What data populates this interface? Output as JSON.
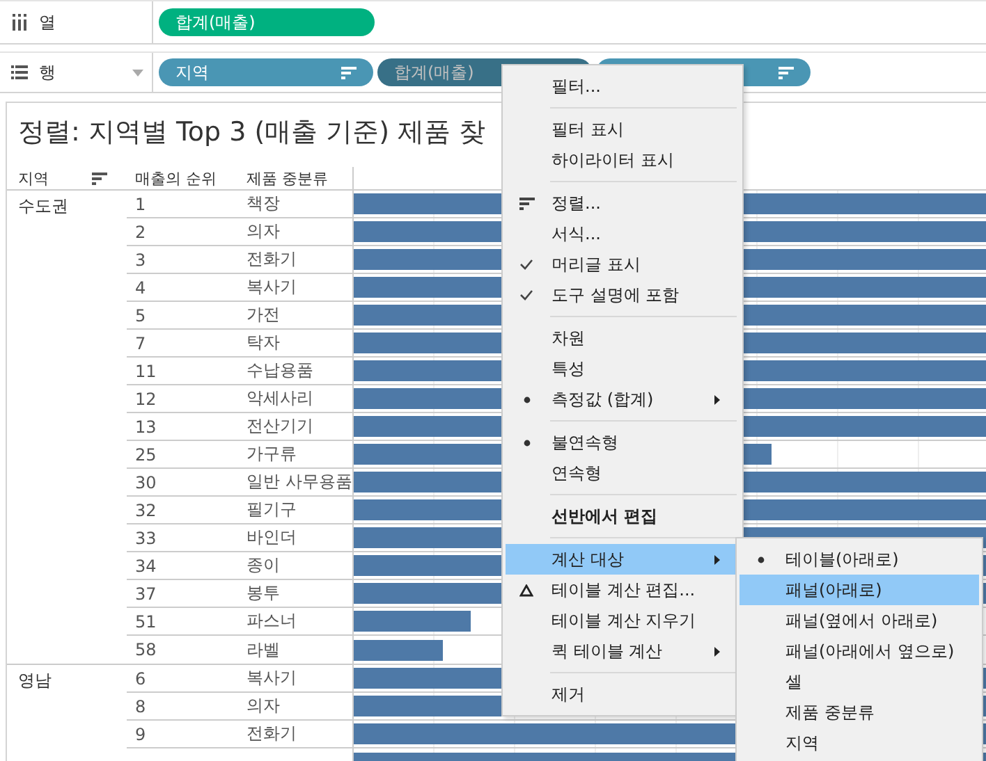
{
  "columns_shelf": {
    "label": "열",
    "pills": [
      {
        "label": "합계(매출)",
        "kind": "continuous",
        "selected": false,
        "sort": false
      }
    ]
  },
  "rows_shelf": {
    "label": "행",
    "pills": [
      {
        "label": "지역",
        "kind": "discrete",
        "selected": false,
        "sort": true
      },
      {
        "label": "합계(매출)",
        "kind": "discrete",
        "selected": true,
        "sort": false
      },
      {
        "kind": "discrete",
        "selected": false,
        "sort": true
      }
    ]
  },
  "title": "정렬: 지역별 Top 3 (매출 기준) 제품 찾",
  "table": {
    "columns": [
      "지역",
      "매출의 순위",
      "제품 중분류"
    ],
    "groups": [
      {
        "region": "수도권",
        "rows": [
          {
            "rank": "1",
            "product": "책장",
            "level": 1
          },
          {
            "rank": "2",
            "product": "의자",
            "level": 1
          },
          {
            "rank": "3",
            "product": "전화기",
            "level": 1
          },
          {
            "rank": "4",
            "product": "복사기",
            "level": 1
          },
          {
            "rank": "5",
            "product": "가전",
            "level": 1
          },
          {
            "rank": "7",
            "product": "탁자",
            "level": 1
          },
          {
            "rank": "11",
            "product": "수납용품",
            "level": 1
          },
          {
            "rank": "12",
            "product": "악세사리",
            "level": 1
          },
          {
            "rank": "13",
            "product": "전산기기",
            "level": 1
          },
          {
            "rank": "25",
            "product": "가구류",
            "level": 0.66
          },
          {
            "rank": "30",
            "product": "일반 사무용품",
            "level": 1
          },
          {
            "rank": "32",
            "product": "필기구",
            "level": 1
          },
          {
            "rank": "33",
            "product": "바인더",
            "level": 1
          },
          {
            "rank": "34",
            "product": "종이",
            "level": 1
          },
          {
            "rank": "37",
            "product": "봉투",
            "level": 1
          },
          {
            "rank": "51",
            "product": "파스너",
            "level": 0.185
          },
          {
            "rank": "58",
            "product": "라벨",
            "level": 0.14
          }
        ]
      },
      {
        "region": "영남",
        "rows": [
          {
            "rank": "6",
            "product": "복사기",
            "level": 1
          },
          {
            "rank": "8",
            "product": "의자",
            "level": 1
          },
          {
            "rank": "9",
            "product": "전화기",
            "level": 1
          },
          {
            "level": 1
          }
        ]
      }
    ]
  },
  "context_menu": {
    "items": [
      {
        "kind": "item",
        "label": "필터..."
      },
      {
        "kind": "separator"
      },
      {
        "kind": "item",
        "label": "필터 표시"
      },
      {
        "kind": "item",
        "label": "하이라이터 표시"
      },
      {
        "kind": "separator"
      },
      {
        "kind": "sort",
        "label": "정렬..."
      },
      {
        "kind": "item",
        "label": "서식..."
      },
      {
        "kind": "toggle",
        "label": "머리글 표시",
        "checked": true
      },
      {
        "kind": "toggle",
        "label": "도구 설명에 포함",
        "checked": true
      },
      {
        "kind": "separator"
      },
      {
        "kind": "item",
        "label": "차원"
      },
      {
        "kind": "item",
        "label": "특성"
      },
      {
        "kind": "radio",
        "label": "측정값 (합계)",
        "checked": true,
        "submenu": true
      },
      {
        "kind": "separator"
      },
      {
        "kind": "radio",
        "label": "불연속형",
        "checked": true
      },
      {
        "kind": "radio",
        "label": "연속형",
        "checked": false
      },
      {
        "kind": "separator"
      },
      {
        "kind": "item",
        "label": "선반에서 편집",
        "bold": true
      },
      {
        "kind": "separator"
      },
      {
        "kind": "item",
        "label": "계산 대상",
        "submenu": true,
        "selected": true
      },
      {
        "kind": "calc",
        "label": "테이블 계산 편집..."
      },
      {
        "kind": "item",
        "label": "테이블 계산 지우기"
      },
      {
        "kind": "item",
        "label": "퀵 테이블 계산",
        "submenu": true
      },
      {
        "kind": "separator"
      },
      {
        "kind": "item",
        "label": "제거"
      }
    ]
  },
  "submenu": {
    "items": [
      {
        "label": "테이블(아래로)",
        "checked": true,
        "selected": false
      },
      {
        "label": "패널(아래로)",
        "checked": false,
        "selected": true
      },
      {
        "label": "패널(옆에서 아래로)",
        "checked": false,
        "selected": false
      },
      {
        "label": "패널(아래에서 옆으로)",
        "checked": false,
        "selected": false
      },
      {
        "label": "셀",
        "checked": false,
        "selected": false
      },
      {
        "label": "제품 중분류",
        "checked": false,
        "selected": false
      },
      {
        "label": "지역",
        "checked": false,
        "selected": false
      }
    ]
  }
}
